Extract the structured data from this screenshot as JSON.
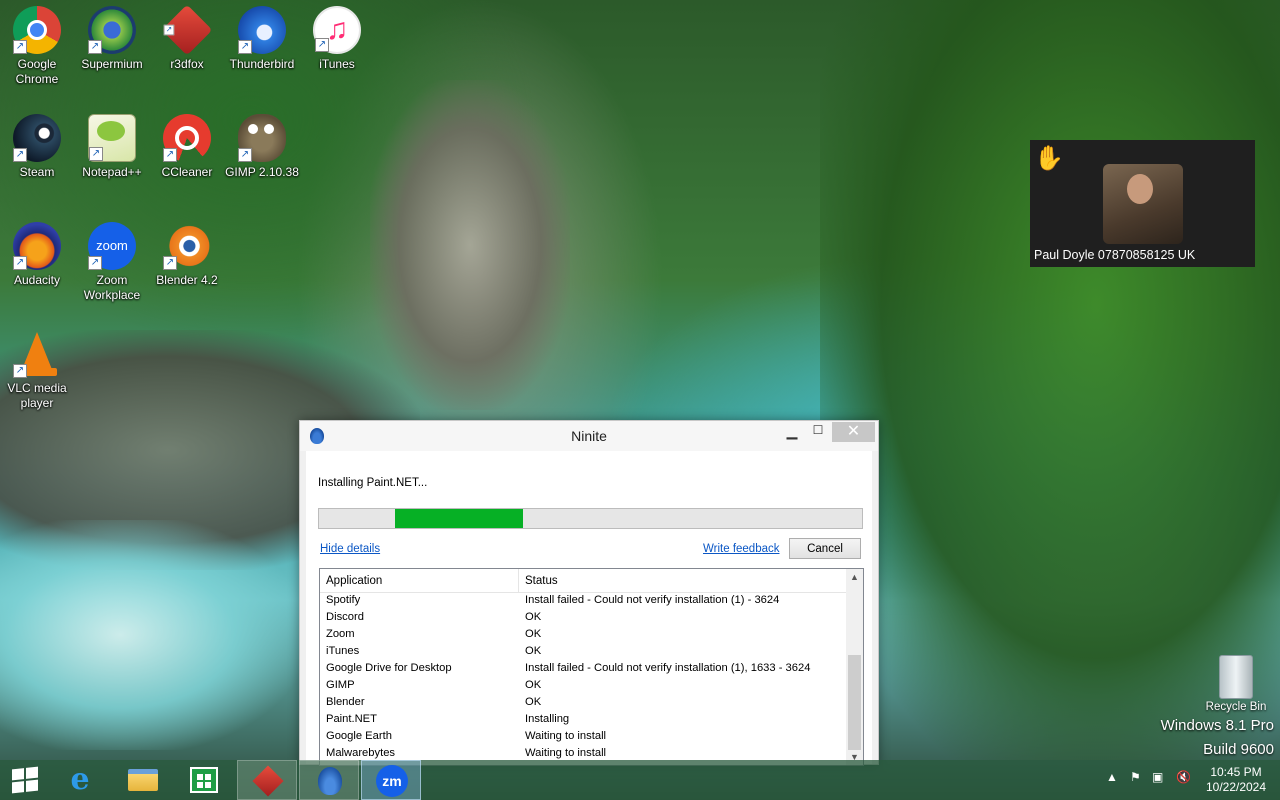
{
  "desktop": {
    "icons": [
      {
        "label": "Google\nChrome",
        "icon": "chrome-icon"
      },
      {
        "label": "Supermium",
        "icon": "supermium-icon"
      },
      {
        "label": "r3dfox",
        "icon": "r3dfox-icon"
      },
      {
        "label": "Thunderbird",
        "icon": "thunderbird-icon"
      },
      {
        "label": "iTunes",
        "icon": "itunes-icon"
      },
      {
        "label": "Steam",
        "icon": "steam-icon"
      },
      {
        "label": "Notepad++",
        "icon": "notepadpp-icon"
      },
      {
        "label": "CCleaner",
        "icon": "ccleaner-icon"
      },
      {
        "label": "GIMP 2.10.38",
        "icon": "gimp-icon"
      },
      {
        "label": "Audacity",
        "icon": "audacity-icon"
      },
      {
        "label": "Zoom\nWorkplace",
        "icon": "zoom-icon"
      },
      {
        "label": "Blender 4.2",
        "icon": "blender-icon"
      },
      {
        "label": "VLC media\nplayer",
        "icon": "vlc-icon"
      }
    ],
    "recycle_bin": "Recycle Bin",
    "watermark_line1": "Windows 8.1 Pro",
    "watermark_line2": "Build 9600"
  },
  "contact_card": {
    "name": "Paul Doyle 07870858125 UK",
    "hand_glyph": "✋"
  },
  "ninite": {
    "title": "Ninite",
    "status": "Installing Paint.NET...",
    "progress_start_fraction": 0.14,
    "progress_end_fraction": 0.375,
    "hide_details": "Hide details",
    "write_feedback": "Write feedback",
    "cancel": "Cancel",
    "columns": {
      "application": "Application",
      "status": "Status"
    },
    "rows": [
      {
        "app": "Spotify",
        "status": "Install failed - Could not verify installation (1) - 3624"
      },
      {
        "app": "Discord",
        "status": "OK"
      },
      {
        "app": "Zoom",
        "status": "OK"
      },
      {
        "app": "iTunes",
        "status": "OK"
      },
      {
        "app": "Google Drive for Desktop",
        "status": "Install failed - Could not verify installation (1), 1633 - 3624"
      },
      {
        "app": "GIMP",
        "status": "OK"
      },
      {
        "app": "Blender",
        "status": "OK"
      },
      {
        "app": "Paint.NET",
        "status": "Installing"
      },
      {
        "app": "Google Earth",
        "status": "Waiting to install"
      },
      {
        "app": "Malwarebytes",
        "status": "Waiting to install"
      }
    ],
    "progress_color": "#06b025"
  },
  "taskbar": {
    "apps": [
      "internet-explorer-icon",
      "file-explorer-icon",
      "store-icon",
      "r3dfox-icon",
      "ninite-icon",
      "zoom-icon"
    ],
    "zoom_label": "zm",
    "time": "10:45 PM",
    "date": "10/22/2024"
  }
}
